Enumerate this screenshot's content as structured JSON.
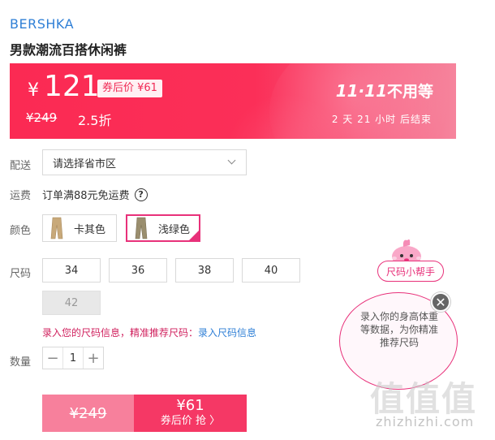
{
  "brand": "BERSHKA",
  "product_title": "男款潮流百搭休闲裤",
  "price": {
    "currency_symbol": "¥",
    "current": "121",
    "coupon_tag": "券后价 ¥61",
    "original": "¥249",
    "discount": "2.5折",
    "promo": "11·11",
    "promo_label": "不用等",
    "countdown": "2 天 21 小时 后结束"
  },
  "delivery": {
    "label": "配送",
    "select_value": "请选择省市区"
  },
  "shipping": {
    "label": "运费",
    "text": "订单满88元免运费",
    "help": "?"
  },
  "color": {
    "label": "颜色",
    "options": [
      {
        "name": "卡其色",
        "swatch": "#c8a97a",
        "selected": false
      },
      {
        "name": "浅绿色",
        "swatch": "#9a8e6e",
        "selected": true
      }
    ]
  },
  "size": {
    "label": "尺码",
    "options": [
      {
        "value": "34",
        "available": true
      },
      {
        "value": "36",
        "available": true
      },
      {
        "value": "38",
        "available": true
      },
      {
        "value": "40",
        "available": true
      },
      {
        "value": "42",
        "available": false
      }
    ],
    "hint": "录入您的尺码信息，精准推荐尺码：",
    "hint_link": "录入尺码信息"
  },
  "quantity": {
    "label": "数量",
    "value": "1",
    "minus": "−",
    "plus": "+"
  },
  "buy": {
    "original": "¥249",
    "price": "¥61",
    "action": "券后价 抢 〉"
  },
  "size_helper": {
    "label": "尺码小帮手",
    "bubble_text": "录入你的身高体重等数据，为你精准推荐尺码",
    "close": "✕"
  },
  "watermark": {
    "logo": "值值值",
    "text": "zhizhizhi.com"
  },
  "colors": {
    "accent": "#f53865",
    "brand_link": "#2f7fd6",
    "helper_pink": "#e8317a"
  }
}
